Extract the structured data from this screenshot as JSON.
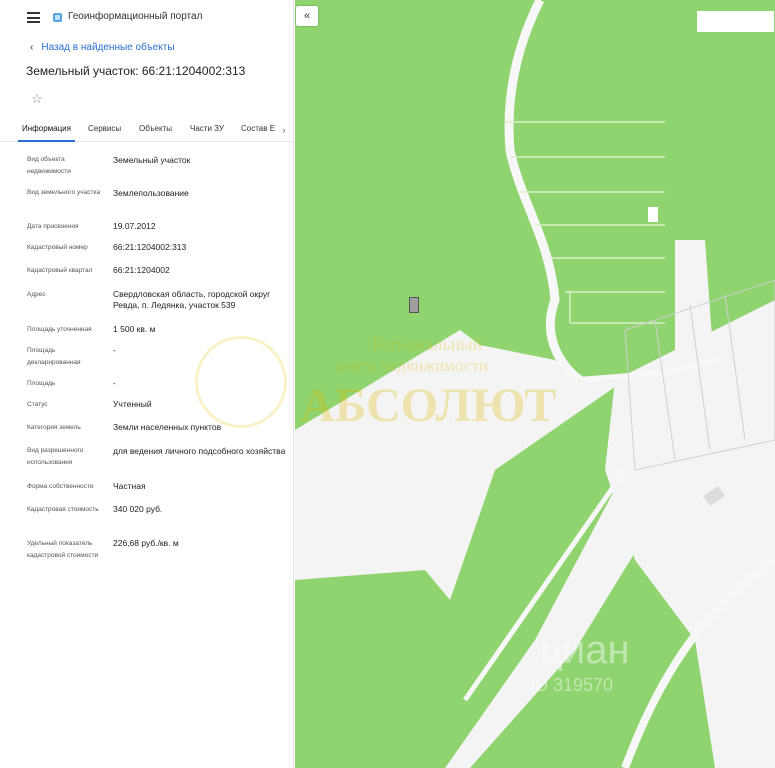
{
  "header": {
    "portal_title": "Геоинформационный портал"
  },
  "nav": {
    "back_label": "Назад в найденные объекты"
  },
  "object": {
    "title": "Земельный участок: 66:21:1204002:313"
  },
  "tabs": [
    {
      "label": "Информация"
    },
    {
      "label": "Сервисы"
    },
    {
      "label": "Объекты"
    },
    {
      "label": "Части ЗУ"
    },
    {
      "label": "Состав Е"
    }
  ],
  "properties": [
    {
      "label": "Вид объекта недвижимости",
      "value": "Земельный участок"
    },
    {
      "label": "Вид земельного участка",
      "value": "Землепользование"
    },
    {
      "label": "Дата присвоения",
      "value": "19.07.2012"
    },
    {
      "label": "Кадастровый номер",
      "value": "66:21:1204002:313"
    },
    {
      "label": "Кадастровый квартал",
      "value": "66:21:1204002"
    },
    {
      "label": "Адрес",
      "value": "Свердловская область, городской округ Ревда, п. Ледянка, участок 539"
    },
    {
      "label": "Площадь уточненная",
      "value": "1 500 кв. м"
    },
    {
      "label": "Площадь декларированная",
      "value": "-"
    },
    {
      "label": "Площадь",
      "value": "-"
    },
    {
      "label": "Статус",
      "value": "Учтенный"
    },
    {
      "label": "Категория земель",
      "value": "Земли населенных пунктов"
    },
    {
      "label": "Вид разрешенного использования",
      "value": "для ведения личного подсобного хозяйства"
    },
    {
      "label": "Форма собственности",
      "value": "Частная"
    },
    {
      "label": "Кадастровая стоимость",
      "value": "340 020 руб."
    },
    {
      "label": "Удельный показатель кадастровой стоимости",
      "value": "226,68 руб./кв. м"
    }
  ],
  "watermarks": {
    "line1": "Региональный",
    "line2": "центр недвижимости",
    "line3": "АБСОЛЮТ",
    "cian": "циан",
    "cian_id": "ID 319570"
  },
  "colors": {
    "accent": "#2b6fd6",
    "forest": "#8fd46f",
    "open_land": "#f4f4f4"
  },
  "icons": {
    "menu": "hamburger-icon",
    "portal": "portal-logo-icon",
    "back": "chevron-left-icon",
    "favorite": "star-icon",
    "tabs_more": "chevron-right-icon",
    "collapse": "double-chevron-left-icon"
  }
}
